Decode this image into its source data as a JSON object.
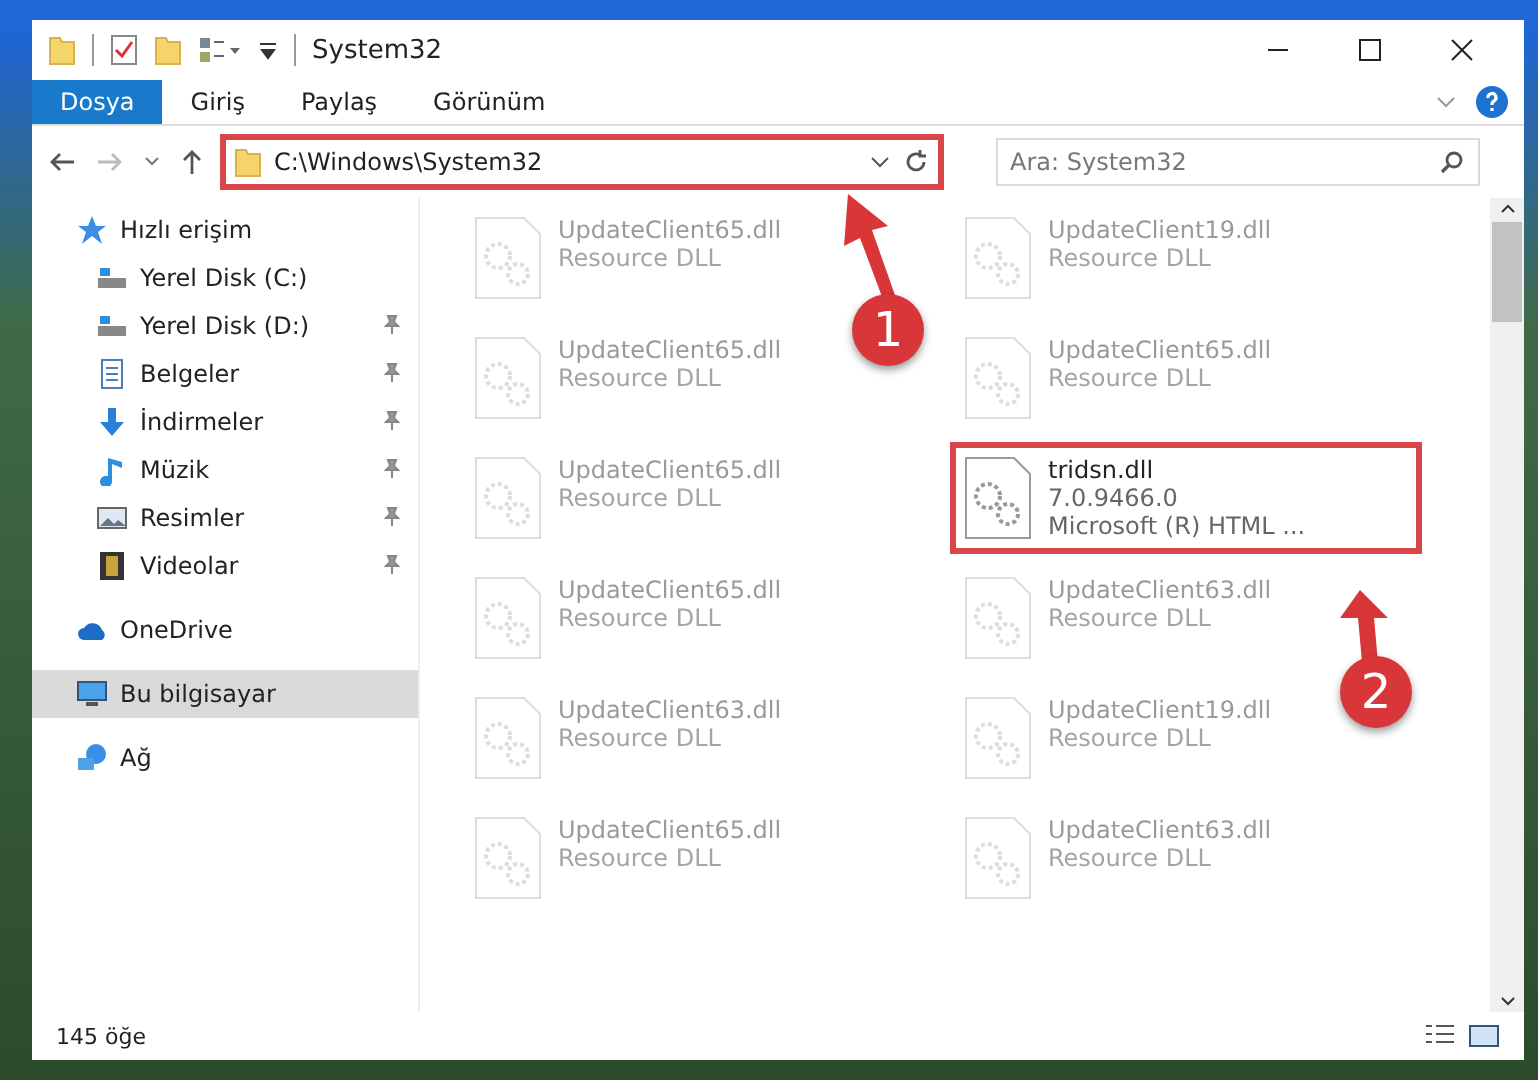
{
  "window": {
    "title": "System32"
  },
  "ribbon_tabs": [
    {
      "label": "Dosya",
      "selected": true
    },
    {
      "label": "Giriş",
      "selected": false
    },
    {
      "label": "Paylaş",
      "selected": false
    },
    {
      "label": "Görünüm",
      "selected": false
    }
  ],
  "address_bar": {
    "path": "C:\\Windows\\System32",
    "highlighted": true
  },
  "search": {
    "placeholder": "Ara: System32"
  },
  "sidebar": {
    "items": [
      {
        "label": "Hızlı erişim",
        "kind": "star",
        "pinned": false,
        "selected": false,
        "children": [
          {
            "label": "Yerel Disk (C:)",
            "kind": "drive",
            "pinned": false,
            "selected": false
          },
          {
            "label": "Yerel Disk (D:)",
            "kind": "drive",
            "pinned": true,
            "selected": false
          },
          {
            "label": "Belgeler",
            "kind": "doc",
            "pinned": true,
            "selected": false
          },
          {
            "label": "İndirmeler",
            "kind": "download",
            "pinned": true,
            "selected": false
          },
          {
            "label": "Müzik",
            "kind": "music",
            "pinned": true,
            "selected": false
          },
          {
            "label": "Resimler",
            "kind": "pictures",
            "pinned": true,
            "selected": false
          },
          {
            "label": "Videolar",
            "kind": "video",
            "pinned": true,
            "selected": false
          }
        ]
      },
      {
        "label": "OneDrive",
        "kind": "cloud",
        "pinned": false,
        "selected": false
      },
      {
        "label": "Bu bilgisayar",
        "kind": "pc",
        "pinned": false,
        "selected": true
      },
      {
        "label": "Ağ",
        "kind": "network",
        "pinned": false,
        "selected": false
      }
    ]
  },
  "files": [
    {
      "name": "UpdateClient65.dll",
      "lines": [
        "Resource DLL"
      ],
      "faded": true,
      "highlighted": false
    },
    {
      "name": "UpdateClient19.dll",
      "lines": [
        "Resource DLL"
      ],
      "faded": true,
      "highlighted": false
    },
    {
      "name": "UpdateClient65.dll",
      "lines": [
        "Resource DLL"
      ],
      "faded": true,
      "highlighted": false
    },
    {
      "name": "UpdateClient65.dll",
      "lines": [
        "Resource DLL"
      ],
      "faded": true,
      "highlighted": false
    },
    {
      "name": "UpdateClient65.dll",
      "lines": [
        "Resource DLL"
      ],
      "faded": true,
      "highlighted": false
    },
    {
      "name": "tridsn.dll",
      "lines": [
        "7.0.9466.0",
        "Microsoft (R) HTML ..."
      ],
      "faded": false,
      "highlighted": true
    },
    {
      "name": "UpdateClient65.dll",
      "lines": [
        "Resource DLL"
      ],
      "faded": true,
      "highlighted": false
    },
    {
      "name": "UpdateClient63.dll",
      "lines": [
        "Resource DLL"
      ],
      "faded": true,
      "highlighted": false
    },
    {
      "name": "UpdateClient63.dll",
      "lines": [
        "Resource DLL"
      ],
      "faded": true,
      "highlighted": false
    },
    {
      "name": "UpdateClient19.dll",
      "lines": [
        "Resource DLL"
      ],
      "faded": true,
      "highlighted": false
    },
    {
      "name": "UpdateClient65.dll",
      "lines": [
        "Resource DLL"
      ],
      "faded": true,
      "highlighted": false
    },
    {
      "name": "UpdateClient63.dll",
      "lines": [
        "Resource DLL"
      ],
      "faded": true,
      "highlighted": false
    }
  ],
  "annotations": [
    {
      "number": "1"
    },
    {
      "number": "2"
    }
  ],
  "status_bar": {
    "count": "145 öğe"
  }
}
